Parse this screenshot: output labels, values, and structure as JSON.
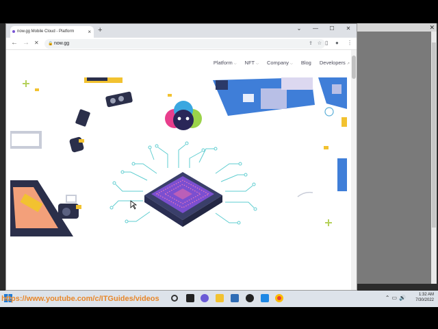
{
  "browser": {
    "tab_title": "now.gg Mobile Cloud - Platform",
    "tab_close": "×",
    "new_tab": "+",
    "window_controls": [
      "⌄",
      "—",
      "☐",
      "✕"
    ],
    "url": "now.gg",
    "nav": {
      "back": "←",
      "forward": "→",
      "reload": "✕"
    }
  },
  "site": {
    "nav": [
      {
        "label": "Platform",
        "chevron": "⌵"
      },
      {
        "label": "NFT",
        "chevron": "⌵"
      },
      {
        "label": "Company",
        "chevron": "⌵"
      },
      {
        "label": "Blog",
        "chevron": ""
      },
      {
        "label": "Developers",
        "chevron": "↗"
      }
    ]
  },
  "taskbar": {
    "overlay_url": "https://www.youtube.com/c/ITGuides/videos",
    "time": "1:32 AM",
    "date": "7/30/2022"
  },
  "colors": {
    "accent_purple": "#6c4fd3",
    "logo_pink": "#e83e8c",
    "logo_blue": "#3aa7e0",
    "logo_green": "#9bd34a",
    "ticker_orange": "#e8872a"
  }
}
